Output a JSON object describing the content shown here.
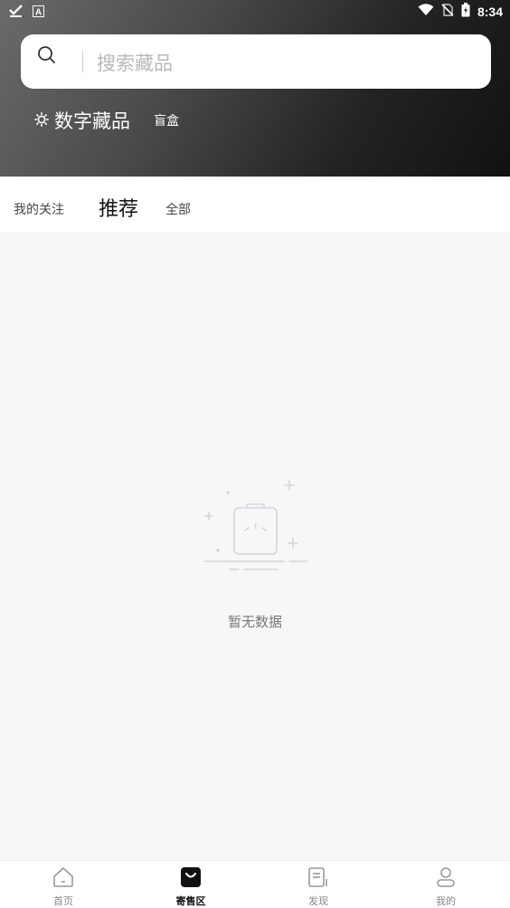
{
  "status_bar": {
    "time": "8:34",
    "left_icons": [
      "check-download-icon",
      "a-app-icon"
    ],
    "right_icons": [
      "wifi-icon",
      "no-sim-icon",
      "battery-charging-icon"
    ]
  },
  "search": {
    "placeholder": "搜索藏品",
    "icon": "search-icon"
  },
  "category_tabs": [
    {
      "label": "数字藏品",
      "active": true,
      "icon": "sun-icon"
    },
    {
      "label": "盲盒",
      "active": false
    }
  ],
  "content_tabs": [
    {
      "label": "我的关注",
      "active": false
    },
    {
      "label": "推荐",
      "active": true
    },
    {
      "label": "全部",
      "active": false
    }
  ],
  "empty_state": {
    "text": "暂无数据",
    "icon": "empty-clipboard-icon"
  },
  "bottom_nav": [
    {
      "label": "首页",
      "icon": "home-icon",
      "active": false
    },
    {
      "label": "寄售区",
      "icon": "shopping-bag-icon",
      "active": true
    },
    {
      "label": "发现",
      "icon": "document-icon",
      "active": false
    },
    {
      "label": "我的",
      "icon": "user-icon",
      "active": false
    }
  ],
  "colors": {
    "header_gradient_start": "#6a6a6a",
    "header_gradient_end": "#111111",
    "background": "#f7f7f8",
    "accent": "#111111"
  }
}
